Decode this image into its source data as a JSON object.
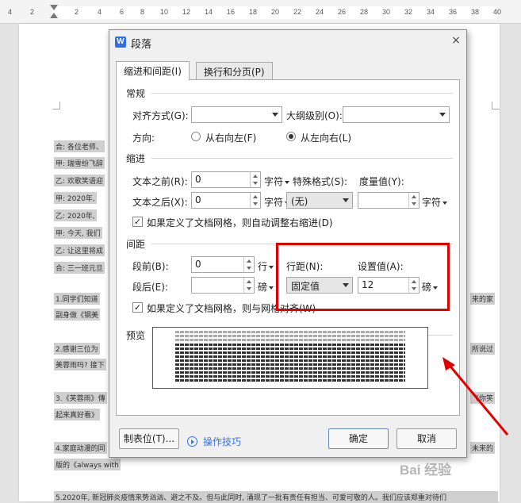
{
  "ruler": {
    "numbers": [
      "4",
      "2",
      "",
      "2",
      "4",
      "6",
      "8",
      "10",
      "12",
      "14",
      "16",
      "18",
      "20",
      "22",
      "24",
      "26",
      "28",
      "30",
      "32",
      "34",
      "36",
      "38",
      "40"
    ]
  },
  "document": {
    "left_lines": [
      "合: 各位老师、",
      "甲: 瑞雪纷飞辞",
      "乙: 欢歌笑语迎",
      "甲: 2020年,",
      "乙: 2020年,",
      "甲: 今天, 我们",
      "乙: 让这里将成",
      "合: 三一班元旦"
    ],
    "para1_start": "1.同学们知道",
    "para1_end": "来的家",
    "para1_line2": "副身做《钢美",
    "para2_start": "2.感谢三位为",
    "para2_end": "所说过",
    "para2_line2": "美蓉雨吗? 接下",
    "para3_start": "3.《芙蓉雨》傳",
    "para3_end": "《你笑",
    "para3_line2": "起来真好看》",
    "para4_start": "4.家庭动漫的同",
    "para4_end": "未来的",
    "para4_line2": "版的《always with",
    "para5": "5.2020年, 新冠肺炎疫情来势汹汹、避之不及。但与此同时, 涌现了一批有责任有担当、可爱可敬的人。我们应该郑重对待们"
  },
  "dialog": {
    "title": "段落",
    "app_icon": "W",
    "close_glyph": "×",
    "tabs": [
      "缩进和间距(I)",
      "换行和分页(P)"
    ],
    "general": {
      "heading": "常规",
      "align_label": "对齐方式(G):",
      "align_value": "",
      "outline_label": "大纲级别(O):",
      "outline_value": "",
      "direction_label": "方向:",
      "rtl_label": "从右向左(F)",
      "ltr_label": "从左向右(L)",
      "direction_selected": "ltr"
    },
    "indent": {
      "heading": "缩进",
      "before_label": "文本之前(R):",
      "before_value": "0",
      "before_unit": "字符",
      "after_label": "文本之后(X):",
      "after_value": "0",
      "after_unit": "字符",
      "special_label": "特殊格式(S):",
      "special_value": "(无)",
      "measure_label": "度量值(Y):",
      "measure_value": "",
      "measure_unit": "字符",
      "auto_adjust_label": "如果定义了文档网格，则自动调整右缩进(D)",
      "auto_adjust_checked": true
    },
    "spacing": {
      "heading": "间距",
      "before_label": "段前(B):",
      "before_value": "0",
      "before_unit": "行",
      "after_label": "段后(E):",
      "after_value": "",
      "after_unit": "磅",
      "line_label": "行距(N):",
      "line_value": "固定值",
      "set_label": "设置值(A):",
      "set_value": "12",
      "set_unit": "磅",
      "grid_label": "如果定义了文档网格，则与网格对齐(W)",
      "grid_checked": true
    },
    "preview": {
      "heading": "预览"
    },
    "buttons": {
      "tabs": "制表位(T)...",
      "tips": "操作技巧",
      "ok": "确定",
      "cancel": "取消"
    }
  },
  "annotation": {
    "highlight_color": "#e00000"
  },
  "watermark": "Bai 经验"
}
